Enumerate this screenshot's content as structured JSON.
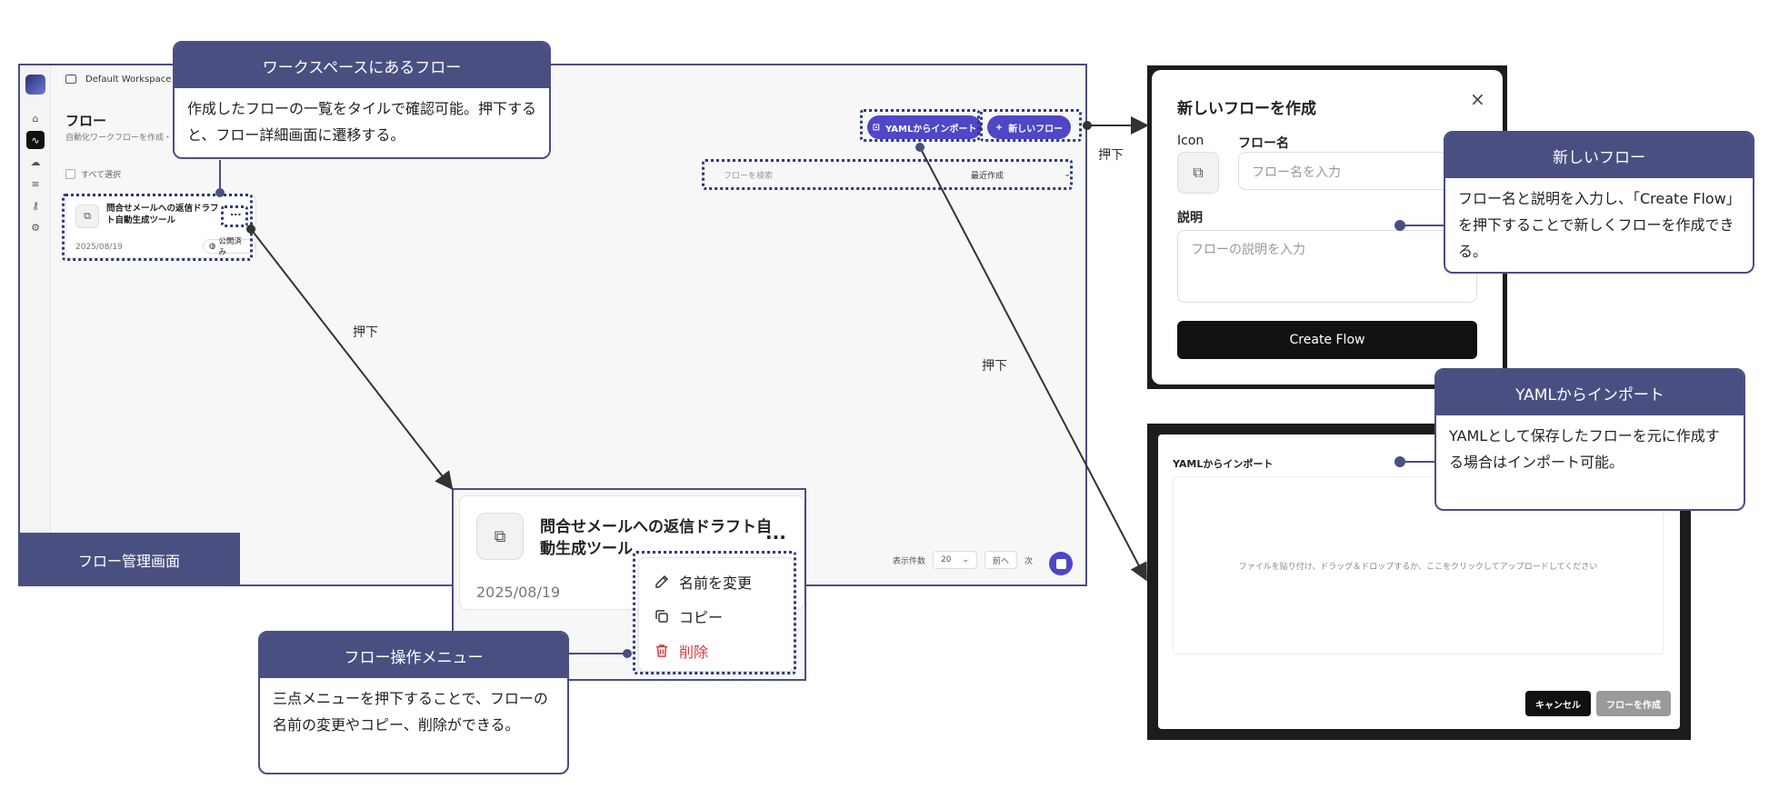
{
  "app": {
    "workspace": "Default Workspace",
    "page_title": "フロー",
    "page_subtitle": "自動化ワークフローを作成・",
    "select_all": "すべて選択",
    "yaml_import_button": "YAMLからインポート",
    "new_flow_button": "新しいフロー",
    "search_placeholder": "フローを検索",
    "sort_value": "最近作成",
    "card": {
      "name": "問合せメールへの返信ドラフト自動生成ツール",
      "dots": "...",
      "date": "2025/08/19",
      "badge": "公開済み"
    },
    "pager": {
      "per_page_label": "表示件数",
      "per_page_value": "20",
      "prev": "前へ",
      "next": "次"
    }
  },
  "screen_label": "フロー管理画面",
  "callouts": {
    "workspace_flows": {
      "title": "ワークスペースにあるフロー",
      "body": "作成したフローの一覧をタイルで確認可能。押下すると、フロー詳細画面に遷移する。"
    },
    "new_flow": {
      "title": "新しいフロー",
      "body": "フロー名と説明を入力し、「Create Flow」を押下することで新しくフローを作成できる。"
    },
    "yaml_import": {
      "title": "YAMLからインポート",
      "body": "YAMLとして保存したフローを元に作成する場合はインポート可能。"
    },
    "flow_menu": {
      "title": "フロー操作メニュー",
      "body": "三点メニューを押下することで、フローの名前の変更やコピー、削除ができる。"
    }
  },
  "zoom": {
    "name": "問合せメールへの返信ドラフト自動生成ツール",
    "dots": "...",
    "date": "2025/08/19",
    "menu": {
      "rename": "名前を変更",
      "copy": "コピー",
      "delete": "削除"
    }
  },
  "new_flow_modal": {
    "title": "新しいフローを作成",
    "close": "×",
    "icon_label": "Icon",
    "name_label": "フロー名",
    "name_placeholder": "フロー名を入力",
    "desc_label": "説明",
    "desc_placeholder": "フローの説明を入力",
    "create_button": "Create Flow"
  },
  "yaml_modal": {
    "title": "YAMLからインポート",
    "drop_text": "ファイルを貼り付け、ドラッグ＆ドロップするか、ここをクリックしてアップロードしてください",
    "cancel_button": "キャンセル",
    "create_button": "フローを作成"
  },
  "arrow_labels": {
    "press_1": "押下",
    "press_2": "押下",
    "press_3": "押下"
  },
  "colors": {
    "callout_header": "#4a4f82",
    "accent_button": "#4f46c8",
    "danger": "#e0393e"
  }
}
